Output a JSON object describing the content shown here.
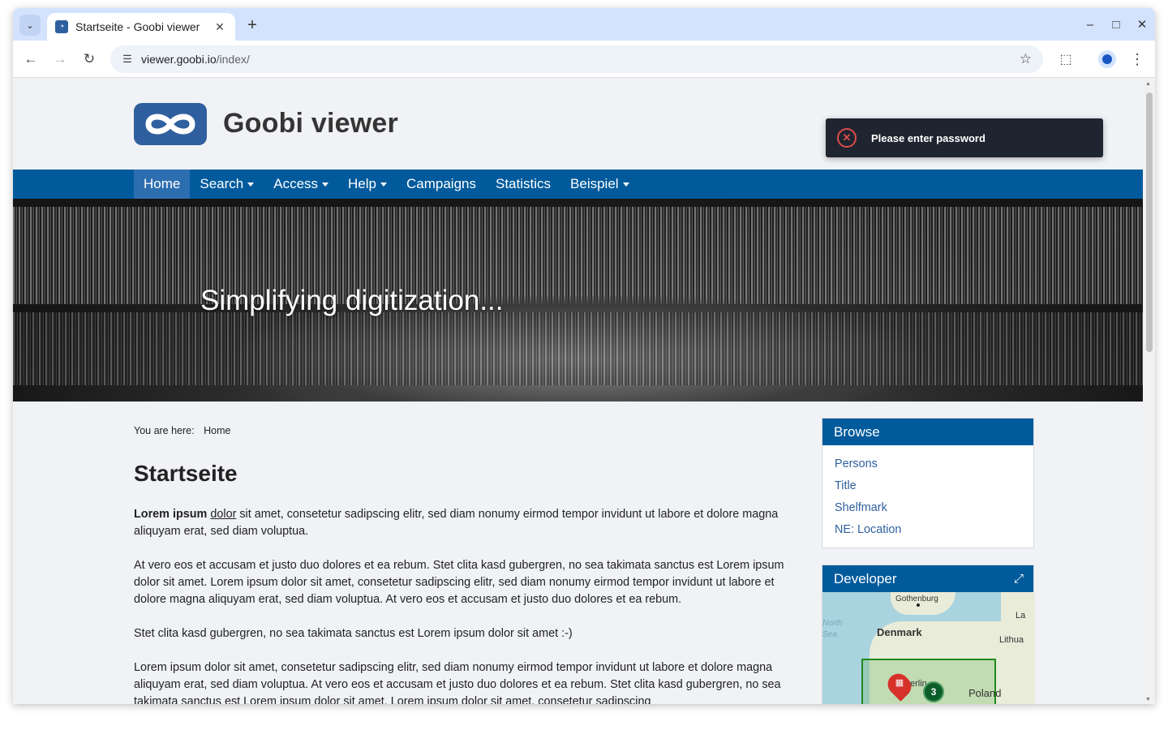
{
  "browser": {
    "tab_title": "Startseite - Goobi viewer",
    "url_host": "viewer.goobi.io",
    "url_path": "/index/"
  },
  "header": {
    "logo_text": "Goobi viewer",
    "toast_message": "Please enter password"
  },
  "nav": {
    "items": [
      {
        "label": "Home"
      },
      {
        "label": "Search"
      },
      {
        "label": "Access"
      },
      {
        "label": "Help"
      },
      {
        "label": "Campaigns"
      },
      {
        "label": "Statistics"
      },
      {
        "label": "Beispiel"
      }
    ]
  },
  "hero": {
    "tagline": "Simplifying digitization..."
  },
  "breadcrumb": {
    "prefix": "You are here:",
    "current": "Home"
  },
  "main": {
    "title": "Startseite",
    "p1_bold": "Lorem ipsum",
    "p1_link": "dolor",
    "p1_rest": " sit amet, consetetur sadipscing elitr, sed diam nonumy eirmod tempor invidunt ut labore et dolore magna aliquyam erat, sed diam voluptua.",
    "p2": "At vero eos et accusam et justo duo dolores et ea rebum. Stet clita kasd gubergren, no sea takimata sanctus est Lorem ipsum dolor sit amet. Lorem ipsum dolor sit amet, consetetur sadipscing elitr, sed diam nonumy eirmod tempor invidunt ut labore et dolore magna aliquyam erat, sed diam voluptua. At vero eos et accusam et justo duo dolores et ea rebum.",
    "p3": "Stet clita kasd gubergren, no sea takimata sanctus est Lorem ipsum dolor sit amet :-)",
    "p4": "Lorem ipsum dolor sit amet, consetetur sadipscing elitr, sed diam nonumy eirmod tempor invidunt ut labore et dolore magna aliquyam erat, sed diam voluptua. At vero eos et accusam et justo duo dolores et ea rebum. Stet clita kasd gubergren, no sea takimata sanctus est Lorem ipsum dolor sit amet. Lorem ipsum dolor sit amet, consetetur sadipscing"
  },
  "sidebar": {
    "browse_title": "Browse",
    "browse_items": [
      {
        "label": "Persons"
      },
      {
        "label": "Title"
      },
      {
        "label": "Shelfmark"
      },
      {
        "label": "NE: Location"
      }
    ],
    "developer_title": "Developer",
    "map": {
      "labels": {
        "gothenburg": "Gothenburg",
        "denmark": "Denmark",
        "north_sea": "North Sea",
        "la": "La",
        "lithuania": "Lithua",
        "berlin": "erlin",
        "poland": "Poland"
      },
      "cluster_count": "3"
    }
  }
}
